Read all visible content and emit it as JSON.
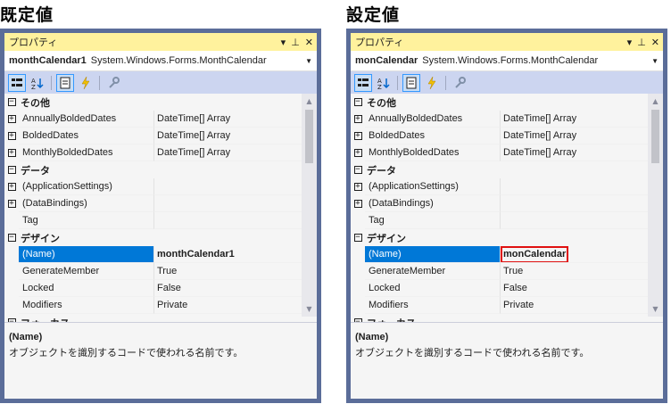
{
  "panels": [
    {
      "heading": "既定値",
      "window_title": "プロパティ",
      "pin_label": "▾ ⊥ ✕",
      "object_name": "monthCalendar1",
      "object_type": "System.Windows.Forms.MonthCalendar",
      "rows": [
        {
          "kind": "cat",
          "label": "その他",
          "exp": "−"
        },
        {
          "kind": "prop",
          "exp": "+",
          "name": "AnnuallyBoldedDates",
          "value": "DateTime[] Array"
        },
        {
          "kind": "prop",
          "exp": "+",
          "name": "BoldedDates",
          "value": "DateTime[] Array"
        },
        {
          "kind": "prop",
          "exp": "+",
          "name": "MonthlyBoldedDates",
          "value": "DateTime[] Array"
        },
        {
          "kind": "cat",
          "label": "データ",
          "exp": "−"
        },
        {
          "kind": "prop",
          "exp": "+",
          "name": "(ApplicationSettings)",
          "value": ""
        },
        {
          "kind": "prop",
          "exp": "+",
          "name": "(DataBindings)",
          "value": ""
        },
        {
          "kind": "prop",
          "exp": "",
          "name": "Tag",
          "value": ""
        },
        {
          "kind": "cat",
          "label": "デザイン",
          "exp": "−"
        },
        {
          "kind": "prop",
          "exp": "",
          "name": "(Name)",
          "value": "monthCalendar1",
          "selected": true,
          "edited": false
        },
        {
          "kind": "prop",
          "exp": "",
          "name": "GenerateMember",
          "value": "True"
        },
        {
          "kind": "prop",
          "exp": "",
          "name": "Locked",
          "value": "False"
        },
        {
          "kind": "prop",
          "exp": "",
          "name": "Modifiers",
          "value": "Private"
        },
        {
          "kind": "cat",
          "label": "フォーカス",
          "exp": "−"
        }
      ],
      "desc_title": "(Name)",
      "desc_text": "オブジェクトを識別するコードで使われる名前です。"
    },
    {
      "heading": "設定値",
      "window_title": "プロパティ",
      "object_name": "monCalendar",
      "object_type": "System.Windows.Forms.MonthCalendar",
      "rows": [
        {
          "kind": "cat",
          "label": "その他",
          "exp": "−"
        },
        {
          "kind": "prop",
          "exp": "+",
          "name": "AnnuallyBoldedDates",
          "value": "DateTime[] Array"
        },
        {
          "kind": "prop",
          "exp": "+",
          "name": "BoldedDates",
          "value": "DateTime[] Array"
        },
        {
          "kind": "prop",
          "exp": "+",
          "name": "MonthlyBoldedDates",
          "value": "DateTime[] Array"
        },
        {
          "kind": "cat",
          "label": "データ",
          "exp": "−"
        },
        {
          "kind": "prop",
          "exp": "+",
          "name": "(ApplicationSettings)",
          "value": ""
        },
        {
          "kind": "prop",
          "exp": "+",
          "name": "(DataBindings)",
          "value": ""
        },
        {
          "kind": "prop",
          "exp": "",
          "name": "Tag",
          "value": ""
        },
        {
          "kind": "cat",
          "label": "デザイン",
          "exp": "−"
        },
        {
          "kind": "prop",
          "exp": "",
          "name": "(Name)",
          "value": "monCalendar",
          "selected": true,
          "edited": true
        },
        {
          "kind": "prop",
          "exp": "",
          "name": "GenerateMember",
          "value": "True"
        },
        {
          "kind": "prop",
          "exp": "",
          "name": "Locked",
          "value": "False"
        },
        {
          "kind": "prop",
          "exp": "",
          "name": "Modifiers",
          "value": "Private"
        },
        {
          "kind": "cat",
          "label": "フォーカス",
          "exp": "−"
        }
      ],
      "desc_title": "(Name)",
      "desc_text": "オブジェクトを識別するコードで使われる名前です。"
    }
  ],
  "colors": {
    "frame": "#5b6d99",
    "titlebar": "#fff29d",
    "toolbar": "#ccd5f0",
    "selection": "#0078d7",
    "highlight_box": "#e01010"
  },
  "icons": [
    "categorized-icon",
    "alphabetical-icon",
    "properties-icon",
    "events-icon",
    "property-pages-icon"
  ]
}
